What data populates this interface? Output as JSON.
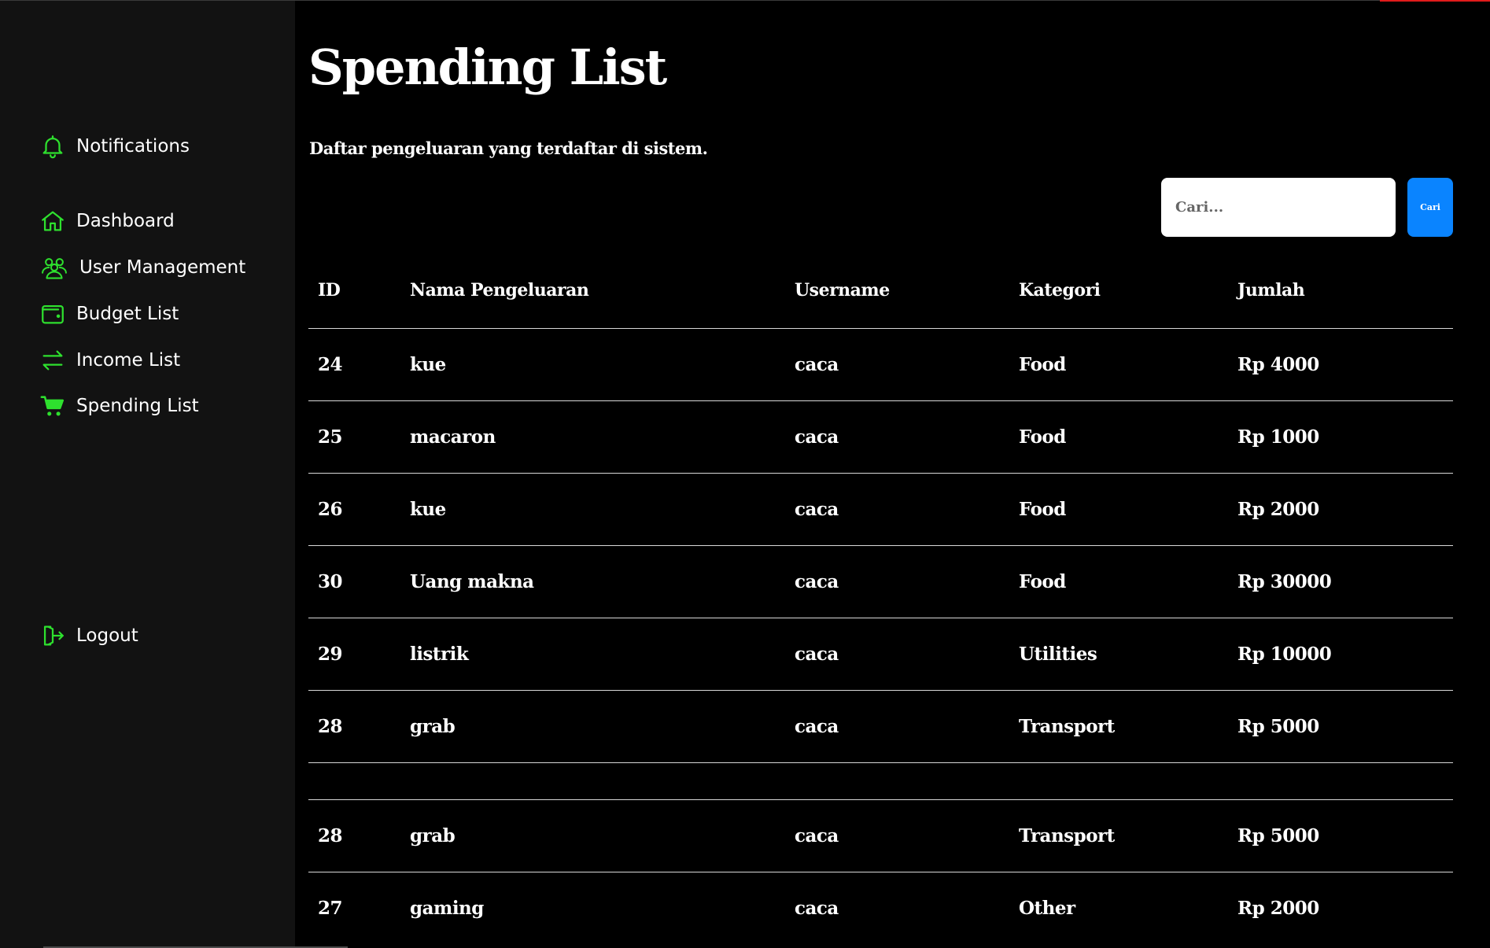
{
  "sidebar": {
    "notifications": {
      "label": "Notifications",
      "icon": "bell-icon"
    },
    "items": [
      {
        "label": "Dashboard",
        "icon": "home-icon"
      },
      {
        "label": "User Management",
        "icon": "users-icon"
      },
      {
        "label": "Budget List",
        "icon": "wallet-icon"
      },
      {
        "label": "Income List",
        "icon": "transfer-arrows-icon"
      },
      {
        "label": "Spending List",
        "icon": "shopping-cart-icon",
        "active": true
      }
    ],
    "logout": {
      "label": "Logout",
      "icon": "logout-icon"
    }
  },
  "main": {
    "title": "Spending List",
    "subtitle": "Daftar pengeluaran yang terdaftar di sistem.",
    "search": {
      "placeholder": "Cari...",
      "value": "",
      "button_label": "Cari"
    },
    "table": {
      "headers": [
        "ID",
        "Nama Pengeluaran",
        "Username",
        "Kategori",
        "Jumlah"
      ],
      "rows": [
        [
          "24",
          "kue",
          "caca",
          "Food",
          "Rp 4000"
        ],
        [
          "25",
          "macaron",
          "caca",
          "Food",
          "Rp 1000"
        ],
        [
          "26",
          "kue",
          "caca",
          "Food",
          "Rp 2000"
        ],
        [
          "30",
          "Uang makna",
          "caca",
          "Food",
          "Rp 30000"
        ],
        [
          "29",
          "listrik",
          "caca",
          "Utilities",
          "Rp 10000"
        ],
        [
          "28",
          "grab",
          "caca",
          "Transport",
          "Rp 5000"
        ],
        [
          "",
          "",
          "",
          "",
          ""
        ],
        [
          "28",
          "grab",
          "caca",
          "Transport",
          "Rp 5000"
        ],
        [
          "27",
          "gaming",
          "caca",
          "Other",
          "Rp 2000"
        ]
      ]
    }
  },
  "colors": {
    "icon_accent": "#2ee02e",
    "sidebar_bg": "#121212",
    "main_bg": "#000000",
    "button_blue": "#0a84ff",
    "top_accent": "#e01b1b"
  }
}
